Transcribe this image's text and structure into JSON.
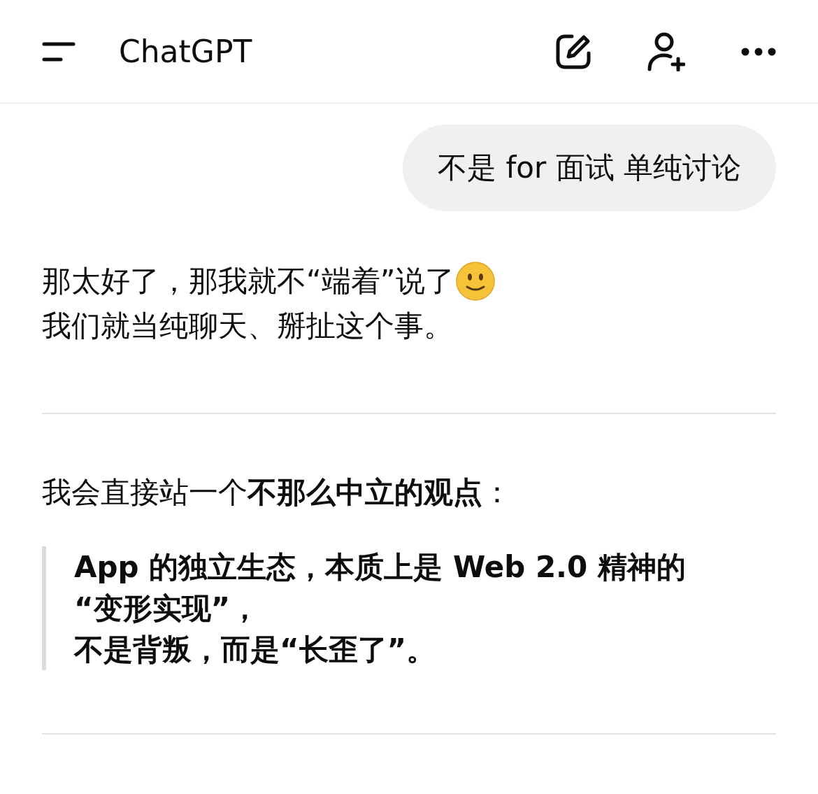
{
  "header": {
    "title": "ChatGPT"
  },
  "user_message": "不是 for 面试 单纯讨论",
  "reply": {
    "lines": [
      "那太好了，那我就不“端着”说了",
      "我们就当纯聊天、掰扯这个事。"
    ],
    "stance": "我会直接站一个**不那么中立的观点**：",
    "quote_lines": [
      "App 的独立生态，本质上是 Web 2.0 精神的",
      "“变形实现”，",
      "不是背叛，而是“长歪了”。"
    ]
  }
}
